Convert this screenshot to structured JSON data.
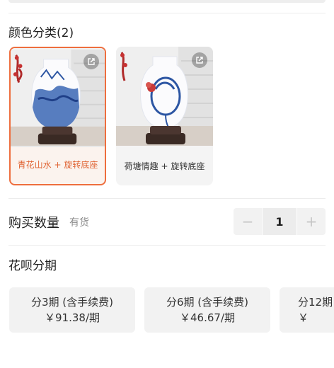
{
  "color_section": {
    "title": "颜色分类(2)",
    "options": [
      {
        "label": "青花山水 + 旋转底座",
        "selected": true
      },
      {
        "label": "荷塘情趣 + 旋转底座",
        "selected": false
      }
    ]
  },
  "quantity": {
    "title": "购买数量",
    "stock_status": "有货",
    "minus": "−",
    "value": "1",
    "plus": "+"
  },
  "installment": {
    "title": "花呗分期",
    "plans": [
      {
        "term": "分3期 (含手续费)",
        "amount": "￥91.38/期"
      },
      {
        "term": "分6期 (含手续费)",
        "amount": "￥46.67/期"
      },
      {
        "term": "分12期",
        "amount": "￥"
      }
    ]
  },
  "colors": {
    "accent": "#ee6e3e",
    "selected_text": "#e06434",
    "muted": "#8a8a8a"
  }
}
